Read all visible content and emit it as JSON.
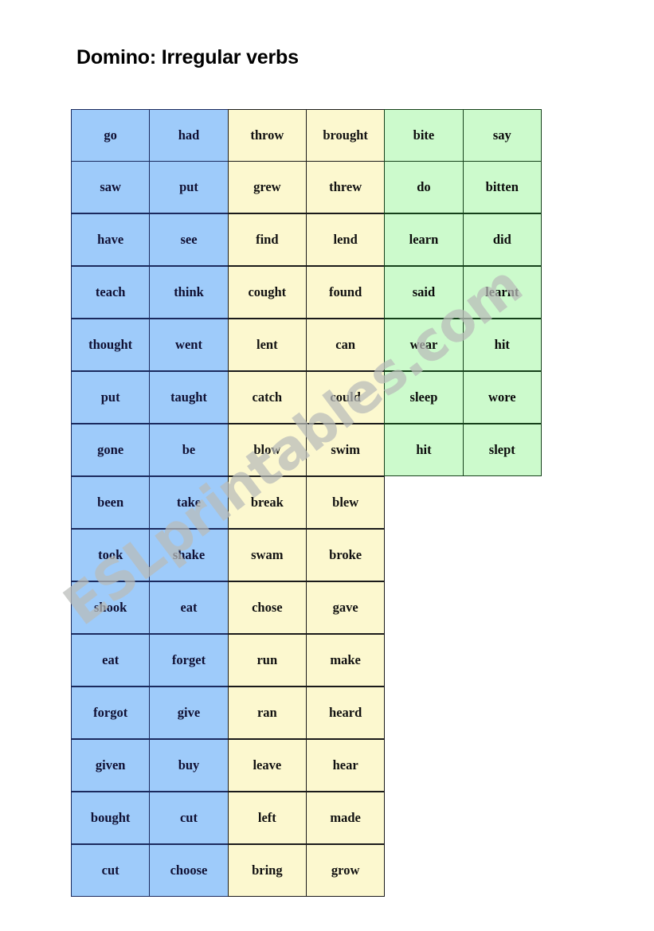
{
  "page": {
    "title": "Domino: Irregular verbs",
    "watermark": "ESLprintables.com"
  },
  "palette": {
    "blue_fill": "#9ecbfa",
    "blue_border": "#1b2a5e",
    "yellow_fill": "#fcf8cf",
    "yellow_border": "#1a1a1a",
    "green_fill": "#ccfacc",
    "green_border": "#15401a",
    "text": "#101033",
    "watermark": "#b9bcb9",
    "background": "#ffffff"
  },
  "grid": {
    "columns": 6,
    "rows": 15,
    "column_colors": [
      "blue",
      "blue",
      "yellow",
      "yellow",
      "green",
      "green"
    ],
    "cells": [
      [
        "go",
        "had",
        "throw",
        "brought",
        "bite",
        "say"
      ],
      [
        "saw",
        "put",
        "grew",
        "threw",
        "do",
        "bitten"
      ],
      [
        "have",
        "see",
        "find",
        "lend",
        "learn",
        "did"
      ],
      [
        "teach",
        "think",
        "cought",
        "found",
        "said",
        "learnt"
      ],
      [
        "thought",
        "went",
        "lent",
        "can",
        "wear",
        "hit"
      ],
      [
        "put",
        "taught",
        "catch",
        "could",
        "sleep",
        "wore"
      ],
      [
        "gone",
        "be",
        "blow",
        "swim",
        "hit",
        "slept"
      ],
      [
        "been",
        "take",
        "break",
        "blew"
      ],
      [
        "took",
        "shake",
        "swam",
        "broke"
      ],
      [
        "shook",
        "eat",
        "chose",
        "gave"
      ],
      [
        "eat",
        "forget",
        "run",
        "make"
      ],
      [
        "forgot",
        "give",
        "ran",
        "heard"
      ],
      [
        "given",
        "buy",
        "leave",
        "hear"
      ],
      [
        "bought",
        "cut",
        "left",
        "made"
      ],
      [
        "cut",
        "choose",
        "bring",
        "grow"
      ]
    ]
  }
}
